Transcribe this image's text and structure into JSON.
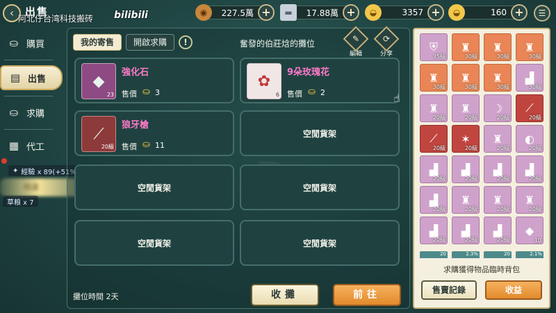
{
  "header": {
    "title": "出售",
    "overlay_text": "阿北仔台湾科技搬砖",
    "bili_logo": "bilibili",
    "currencies": [
      {
        "icon": "coin-icon",
        "value": "227.5萬"
      },
      {
        "icon": "silver-bar-icon",
        "value": "17.88萬"
      },
      {
        "icon": "gold-ingot-icon",
        "value": "3357"
      },
      {
        "icon": "gold-ingot-bound-icon",
        "value": "160"
      }
    ],
    "plus_label": "+",
    "menu_icon": "menu-icon"
  },
  "sidebar": {
    "items": [
      {
        "label": "購買",
        "icon": "ingot-icon"
      },
      {
        "label": "出售",
        "icon": "sell-stall-icon"
      },
      {
        "label": "求購",
        "icon": "request-ingot-icon"
      },
      {
        "label": "代工",
        "icon": "craft-icon"
      }
    ],
    "exp_tip": "經驗 x 89(+51%)",
    "item_tip": "草粮 x 7",
    "partial_label": "档道"
  },
  "main": {
    "tabs": [
      {
        "label": "我的寄售"
      },
      {
        "label": "開啟求購"
      }
    ],
    "info_label": "!",
    "shop_owner": "奮發的伯莊焓的攤位",
    "edit_label": "編輯",
    "share_label": "分享",
    "slots": [
      {
        "name": "強化石",
        "count": "23",
        "price_label": "售價",
        "price": "3",
        "icon": "enhance-stone-icon"
      },
      {
        "name": "9朵玫瑰花",
        "count": "6",
        "price_label": "售價",
        "price": "2",
        "icon": "rose-bouquet-icon"
      },
      {
        "name": "狼牙槍",
        "count": "20級",
        "price_label": "售價",
        "price": "11",
        "icon": "wolf-spear-icon"
      }
    ],
    "empty_slot_label": "空閒貨架",
    "stall_time_label": "攤位時間",
    "stall_time_value": "2天",
    "close_button": "收攤",
    "go_button": "前往"
  },
  "inventory": {
    "cells": [
      {
        "label": "35級",
        "color": "pink",
        "icon": "armor-icon"
      },
      {
        "label": "30級",
        "color": "orange",
        "icon": "robe-icon"
      },
      {
        "label": "30級",
        "color": "orange",
        "icon": "robe-icon"
      },
      {
        "label": "30級",
        "color": "orange",
        "icon": "robe-icon"
      },
      {
        "label": "30級",
        "color": "orange",
        "icon": "robe-icon"
      },
      {
        "label": "30級",
        "color": "orange",
        "icon": "robe-icon"
      },
      {
        "label": "30級",
        "color": "orange",
        "icon": "robe-icon"
      },
      {
        "label": "30級",
        "color": "pink",
        "icon": "boots-icon"
      },
      {
        "label": "20級",
        "color": "pink",
        "icon": "robe-icon"
      },
      {
        "label": "20級",
        "color": "pink",
        "icon": "robe-icon"
      },
      {
        "label": "20級",
        "color": "pink",
        "icon": "bow-icon"
      },
      {
        "label": "20級",
        "color": "red",
        "icon": "staff-icon"
      },
      {
        "label": "20級",
        "color": "red",
        "icon": "spear-icon"
      },
      {
        "label": "20級",
        "color": "red",
        "icon": "claw-icon"
      },
      {
        "label": "20級",
        "color": "pink",
        "icon": "robe-icon"
      },
      {
        "label": "20級",
        "color": "pink",
        "icon": "bracer-icon"
      },
      {
        "label": "20級",
        "color": "pink",
        "icon": "boots-icon"
      },
      {
        "label": "20級",
        "color": "pink",
        "icon": "boots-icon"
      },
      {
        "label": "20級",
        "color": "pink",
        "icon": "boots-icon"
      },
      {
        "label": "20級",
        "color": "pink",
        "icon": "boots-icon"
      },
      {
        "label": "20級",
        "color": "pink",
        "icon": "boots-icon"
      },
      {
        "label": "20級",
        "color": "pink",
        "icon": "robe-icon"
      },
      {
        "label": "20級",
        "color": "pink",
        "icon": "robe-icon"
      },
      {
        "label": "20級",
        "color": "pink",
        "icon": "robe-icon"
      },
      {
        "label": "20級",
        "color": "pink",
        "icon": "boots-icon"
      },
      {
        "label": "20級",
        "color": "pink",
        "icon": "boots-icon"
      },
      {
        "label": "20級",
        "color": "pink",
        "icon": "boots-icon"
      },
      {
        "label": "10",
        "color": "pink",
        "icon": "enhance-stone-icon"
      }
    ],
    "partial_row": [
      "20",
      "2.3%",
      "20",
      "2.1%"
    ],
    "caption": "求購獲得物品臨時背包",
    "record_button": "售賣記錄",
    "income_button": "收益"
  }
}
